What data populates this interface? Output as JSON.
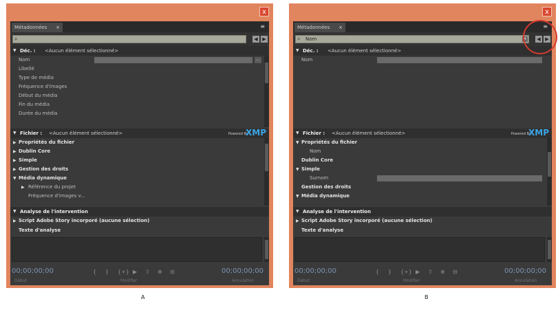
{
  "screen_a": {
    "caption": "A",
    "tab_label": "Métadonnées",
    "tab_close": "×",
    "panel_menu": "≡",
    "search": {
      "value": ""
    },
    "doc_section": {
      "label": "Déc. :",
      "value": "<Aucun élément sélectionné>",
      "fields": [
        "Nom",
        "Libellé",
        "Type de média",
        "Fréquence d'images",
        "Début du média",
        "Fin du média",
        "Durée du média"
      ]
    },
    "file_section": {
      "label": "Fichier :",
      "value": "<Aucun élément sélectionné>",
      "powered_by": "Powered By",
      "xmp": "XMP",
      "items": [
        "Propriétés du fichier",
        "Dublin Core",
        "Simple",
        "Gestion des droits",
        "Média dynamique"
      ],
      "subitems": [
        "Référence du projet",
        "Fréquence d'images v..."
      ]
    },
    "analysis": {
      "title": "Analyse de l'intervention",
      "script": "Script Adobe Story incorporé (aucune sélection)",
      "text_label": "Texte d'analyse"
    },
    "timecode_left": "00;00;00;00",
    "timecode_right": "00;00;00;00",
    "footer": [
      "Début",
      "Modifier",
      "Annulation"
    ]
  },
  "screen_b": {
    "caption": "B",
    "tab_label": "Métadonnées",
    "tab_close": "×",
    "panel_menu": "≡",
    "search": {
      "value": "Nom"
    },
    "doc_section": {
      "label": "Déc. :",
      "value": "<Aucun élément sélectionné>",
      "fields": [
        "Nom"
      ]
    },
    "file_section": {
      "label": "Fichier :",
      "value": "<Aucun élément sélectionné>",
      "powered_by": "Powered By",
      "xmp": "XMP",
      "items": [
        "Propriétés du fichier",
        "Nom",
        "Dublin Core",
        "Simple",
        "Surnom",
        "Gestion des droits",
        "Média dynamique"
      ]
    },
    "analysis": {
      "title": "Analyse de l'intervention",
      "script": "Script Adobe Story incorporé (aucune sélection)",
      "text_label": "Texte d'analyse"
    },
    "timecode_left": "00;00;00;00",
    "timecode_right": "00;00;00;00",
    "footer": [
      "Début",
      "Modifier",
      "Annulation"
    ]
  },
  "icons": {
    "close": "x",
    "search": "⌕",
    "prev": "◀",
    "next": "▶",
    "expanded": "▼",
    "collapsed": "▶",
    "ellipsis": "…",
    "clear_search": "×"
  },
  "colors": {
    "frame": "#e1855e",
    "panel": "#3b3b3b",
    "xmp_blue": "#3aa6e8",
    "highlight_ring": "#d53a2f",
    "timecode": "#7d93b3"
  }
}
